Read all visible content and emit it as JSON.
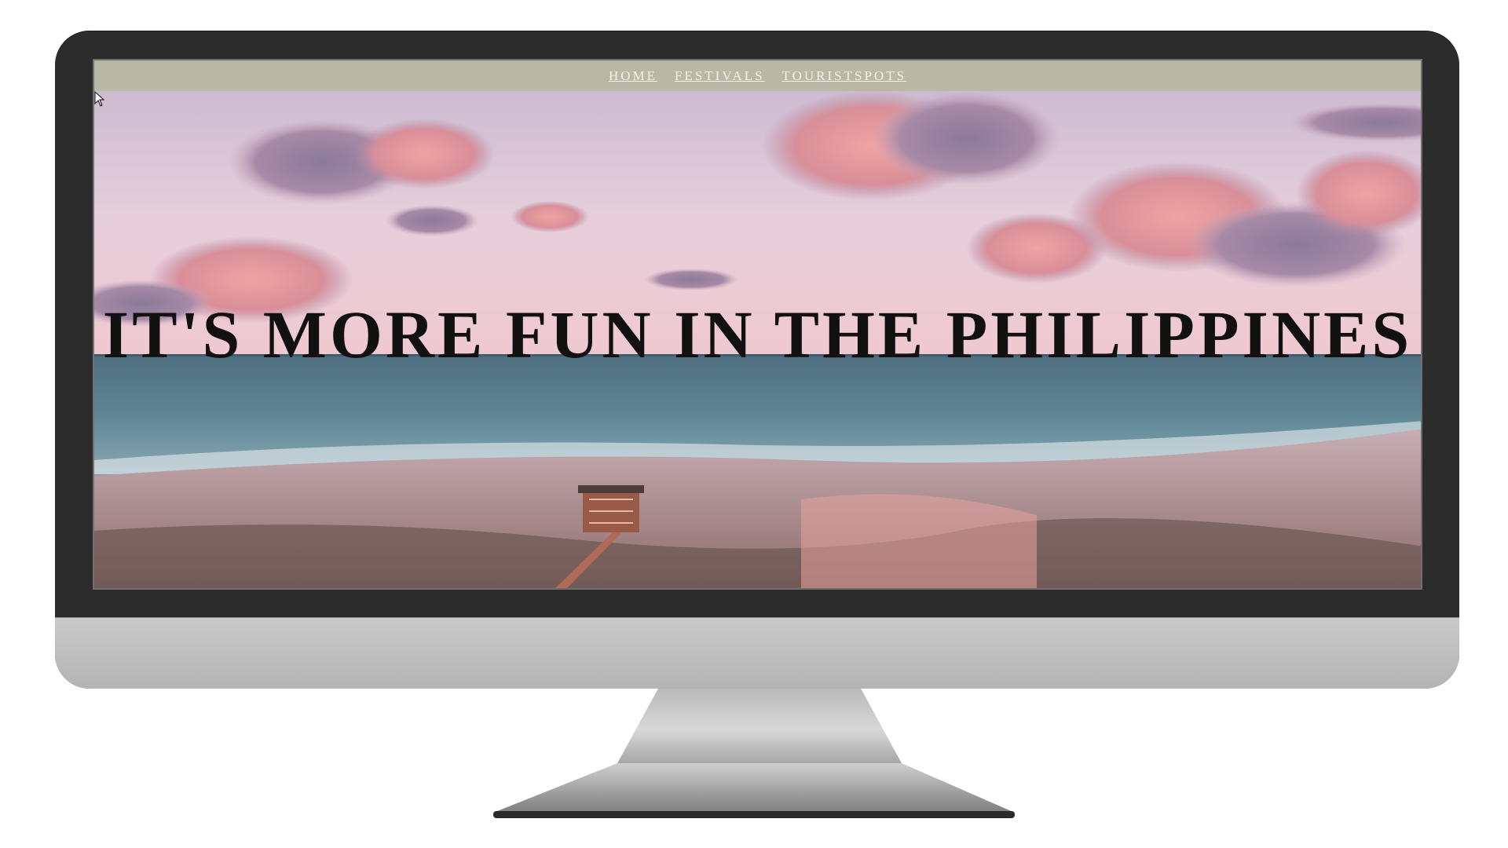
{
  "nav": {
    "links": [
      "HOME",
      "FESTIVALS",
      "TOURISTSPOTS"
    ]
  },
  "hero": {
    "headline": "IT'S MORE FUN IN THE PHILIPPINES",
    "background": "pink-sunset-ocean-pier-photo"
  },
  "colors": {
    "navbar": "#b7b9a5",
    "nav_text": "#f6f3ea",
    "headline": "#111111",
    "bezel": "#2c2c2c",
    "chin": "#c4c4c4"
  },
  "icons": [
    "mouse-cursor-icon"
  ]
}
